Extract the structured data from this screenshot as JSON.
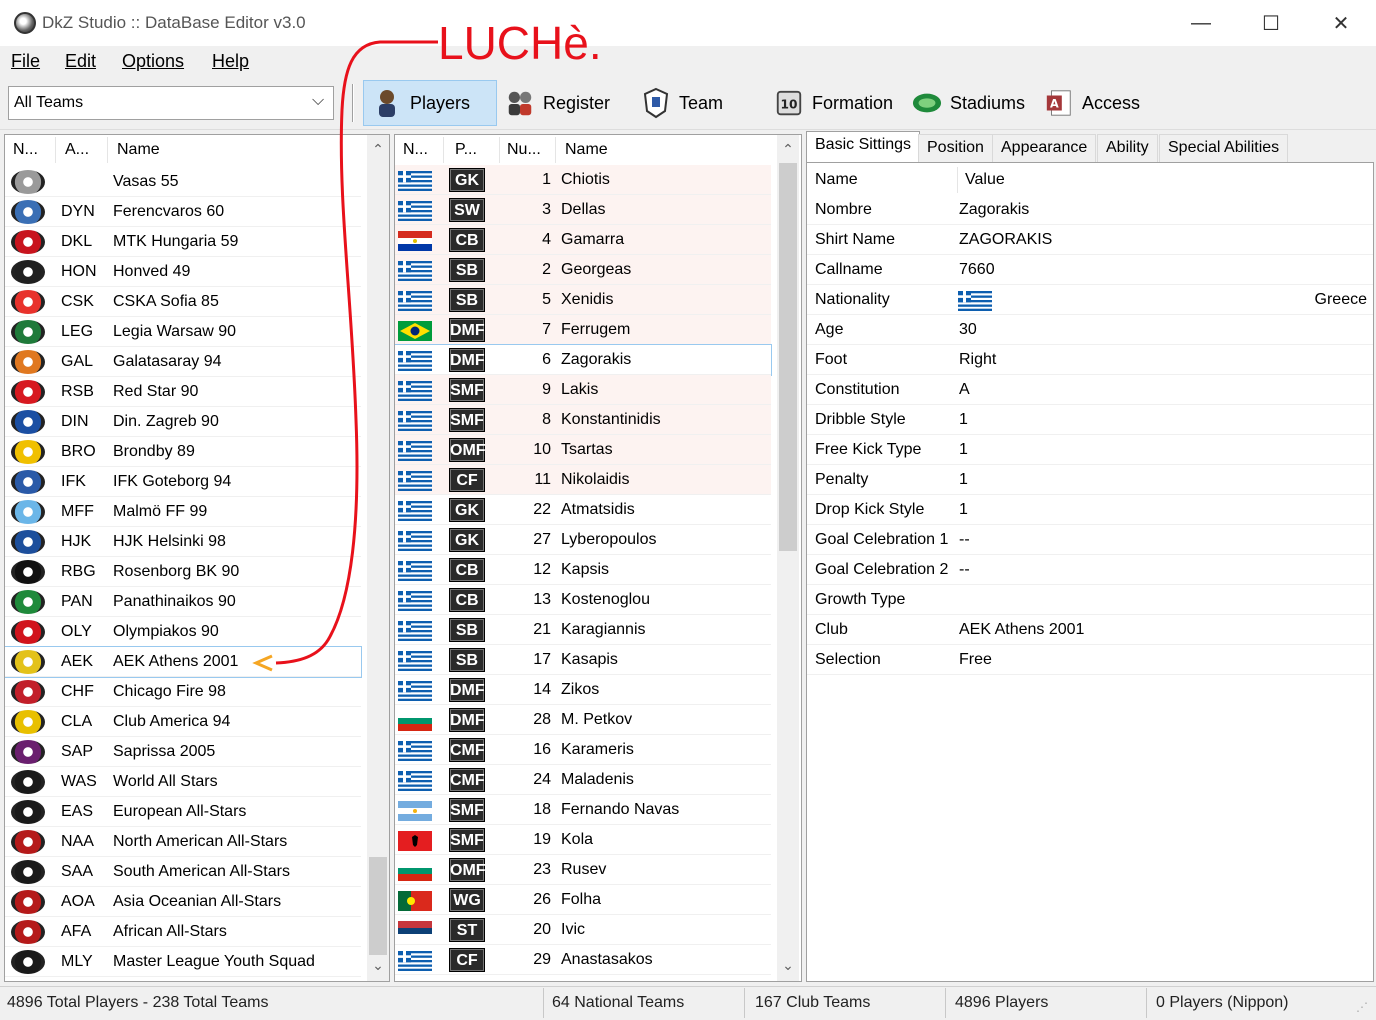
{
  "window": {
    "title": "DkZ Studio :: DataBase Editor v3.0",
    "minimize": "—",
    "maximize": "☐",
    "close": "✕"
  },
  "menu": [
    "File",
    "Edit",
    "Options",
    "Help"
  ],
  "team_filter": {
    "value": "All Teams",
    "arrow": "⌵"
  },
  "toolbar": [
    {
      "label": "Players",
      "icon": "player-icon",
      "active": true
    },
    {
      "label": "Register",
      "icon": "register-icon",
      "active": false
    },
    {
      "label": "Team",
      "icon": "team-icon",
      "active": false
    },
    {
      "label": "Formation",
      "icon": "formation-icon",
      "active": false
    },
    {
      "label": "Stadiums",
      "icon": "stadium-icon",
      "active": false
    },
    {
      "label": "Access",
      "icon": "access-icon",
      "active": false
    }
  ],
  "annotation": {
    "text": "LUCHè."
  },
  "teams": {
    "columns": [
      "N...",
      "A...",
      "Name"
    ],
    "rows": [
      {
        "abbr": "",
        "name": "Vasas 55",
        "logo_color": "#9a9a9a"
      },
      {
        "abbr": "DYN",
        "name": "Ferencvaros 60",
        "logo_color": "#3a6fb5"
      },
      {
        "abbr": "DKL",
        "name": "MTK Hungaria 59",
        "logo_color": "#c8141e"
      },
      {
        "abbr": "HON",
        "name": "Honved 49",
        "logo_color": "#202020"
      },
      {
        "abbr": "CSK",
        "name": "CSKA Sofia 85",
        "logo_color": "#e8322c"
      },
      {
        "abbr": "LEG",
        "name": "Legia Warsaw 90",
        "logo_color": "#1f7a3a"
      },
      {
        "abbr": "GAL",
        "name": "Galatasaray 94",
        "logo_color": "#e07820"
      },
      {
        "abbr": "RSB",
        "name": "Red Star 90",
        "logo_color": "#d71920"
      },
      {
        "abbr": "DIN",
        "name": "Din. Zagreb 90",
        "logo_color": "#1b4fa3"
      },
      {
        "abbr": "BRO",
        "name": "Brondby 89",
        "logo_color": "#f0c000"
      },
      {
        "abbr": "IFK",
        "name": "IFK Goteborg 94",
        "logo_color": "#2a5aa8"
      },
      {
        "abbr": "MFF",
        "name": "Malmö FF 99",
        "logo_color": "#6bb6e8"
      },
      {
        "abbr": "HJK",
        "name": "HJK Helsinki 98",
        "logo_color": "#1d4f9c"
      },
      {
        "abbr": "RBG",
        "name": "Rosenborg BK 90",
        "logo_color": "#111111"
      },
      {
        "abbr": "PAN",
        "name": "Panathinaikos 90",
        "logo_color": "#1f8a3b"
      },
      {
        "abbr": "OLY",
        "name": "Olympiakos 90",
        "logo_color": "#d1141d"
      },
      {
        "abbr": "AEK",
        "name": "AEK Athens 2001",
        "logo_color": "#e3c21a",
        "selected": true
      },
      {
        "abbr": "CHF",
        "name": "Chicago Fire 98",
        "logo_color": "#c21f2a"
      },
      {
        "abbr": "CLA",
        "name": "Club America 94",
        "logo_color": "#e8c000"
      },
      {
        "abbr": "SAP",
        "name": "Saprissa 2005",
        "logo_color": "#6a1f6e"
      },
      {
        "abbr": "WAS",
        "name": "World All Stars",
        "logo_color": "#1a1a1a"
      },
      {
        "abbr": "EAS",
        "name": "European All-Stars",
        "logo_color": "#1a1a1a"
      },
      {
        "abbr": "NAA",
        "name": "North American All-Stars",
        "logo_color": "#b51a1a"
      },
      {
        "abbr": "SAA",
        "name": "South American All-Stars",
        "logo_color": "#1a1a1a"
      },
      {
        "abbr": "AOA",
        "name": "Asia Oceanian All-Stars",
        "logo_color": "#b51a1a"
      },
      {
        "abbr": "AFA",
        "name": "African All-Stars",
        "logo_color": "#b51a1a"
      },
      {
        "abbr": "MLY",
        "name": "Master League Youth Squad",
        "logo_color": "#1a1a1a"
      }
    ]
  },
  "players": {
    "columns": [
      "N...",
      "P...",
      "Nu...",
      "Name"
    ],
    "rows": [
      {
        "flag": "greece",
        "pos": "GK",
        "num": "1",
        "name": "Chiotis"
      },
      {
        "flag": "greece",
        "pos": "SW",
        "num": "3",
        "name": "Dellas"
      },
      {
        "flag": "paraguay",
        "pos": "CB",
        "num": "4",
        "name": "Gamarra"
      },
      {
        "flag": "greece",
        "pos": "SB",
        "num": "2",
        "name": "Georgeas"
      },
      {
        "flag": "greece",
        "pos": "SB",
        "num": "5",
        "name": "Xenidis"
      },
      {
        "flag": "brazil",
        "pos": "DMF",
        "num": "7",
        "name": "Ferrugem"
      },
      {
        "flag": "greece",
        "pos": "DMF",
        "num": "6",
        "name": "Zagorakis",
        "selected": true
      },
      {
        "flag": "greece",
        "pos": "SMF",
        "num": "9",
        "name": "Lakis"
      },
      {
        "flag": "greece",
        "pos": "SMF",
        "num": "8",
        "name": "Konstantinidis"
      },
      {
        "flag": "greece",
        "pos": "OMF",
        "num": "10",
        "name": "Tsartas"
      },
      {
        "flag": "greece",
        "pos": "CF",
        "num": "11",
        "name": "Nikolaidis"
      },
      {
        "flag": "greece",
        "pos": "GK",
        "num": "22",
        "name": "Atmatsidis"
      },
      {
        "flag": "greece",
        "pos": "GK",
        "num": "27",
        "name": "Lyberopoulos"
      },
      {
        "flag": "greece",
        "pos": "CB",
        "num": "12",
        "name": "Kapsis"
      },
      {
        "flag": "greece",
        "pos": "CB",
        "num": "13",
        "name": "Kostenoglou"
      },
      {
        "flag": "greece",
        "pos": "SB",
        "num": "21",
        "name": "Karagiannis"
      },
      {
        "flag": "greece",
        "pos": "SB",
        "num": "17",
        "name": "Kasapis"
      },
      {
        "flag": "greece",
        "pos": "DMF",
        "num": "14",
        "name": "Zikos"
      },
      {
        "flag": "bulgaria",
        "pos": "DMF",
        "num": "28",
        "name": "M. Petkov"
      },
      {
        "flag": "greece",
        "pos": "CMF",
        "num": "16",
        "name": "Karameris"
      },
      {
        "flag": "greece",
        "pos": "CMF",
        "num": "24",
        "name": "Maladenis"
      },
      {
        "flag": "argentina",
        "pos": "SMF",
        "num": "18",
        "name": "Fernando Navas"
      },
      {
        "flag": "albania",
        "pos": "SMF",
        "num": "19",
        "name": "Kola"
      },
      {
        "flag": "bulgaria",
        "pos": "OMF",
        "num": "23",
        "name": "Rusev"
      },
      {
        "flag": "portugal",
        "pos": "WG",
        "num": "26",
        "name": "Folha"
      },
      {
        "flag": "serbia",
        "pos": "ST",
        "num": "20",
        "name": "Ivic"
      },
      {
        "flag": "greece",
        "pos": "CF",
        "num": "29",
        "name": "Anastasakos"
      }
    ]
  },
  "detail": {
    "tabs": [
      "Basic Sittings",
      "Position",
      "Appearance",
      "Ability",
      "Special Abilities"
    ],
    "columns": [
      "Name",
      "Value"
    ],
    "rows": [
      {
        "name": "Nombre",
        "value": "Zagorakis"
      },
      {
        "name": "Shirt Name",
        "value": "ZAGORAKIS"
      },
      {
        "name": "Callname",
        "value": "7660"
      },
      {
        "name": "Nationality",
        "value": "",
        "flag": "greece",
        "extra": "Greece"
      },
      {
        "name": "Age",
        "value": "30"
      },
      {
        "name": "Foot",
        "value": "Right"
      },
      {
        "name": "Constitution",
        "value": "A"
      },
      {
        "name": "Dribble Style",
        "value": "1"
      },
      {
        "name": "Free Kick Type",
        "value": "1"
      },
      {
        "name": "Penalty",
        "value": "1"
      },
      {
        "name": "Drop Kick Style",
        "value": "1"
      },
      {
        "name": "Goal Celebration 1",
        "value": "--"
      },
      {
        "name": "Goal Celebration 2",
        "value": "--"
      },
      {
        "name": "Growth Type",
        "value": ""
      },
      {
        "name": "Club",
        "value": "AEK Athens 2001"
      },
      {
        "name": "Selection",
        "value": "Free"
      }
    ]
  },
  "status": {
    "total": "4896 Total Players  -  238 Total Teams",
    "national": "64 National Teams",
    "club": "167 Club Teams",
    "players": "4896 Players",
    "nippon": "0 Players (Nippon)"
  },
  "colors": {
    "accent": "#cce4f7",
    "annotation": "#e8111b",
    "arrow": "#f5a623",
    "greece_blue": "#0d5eaf"
  }
}
